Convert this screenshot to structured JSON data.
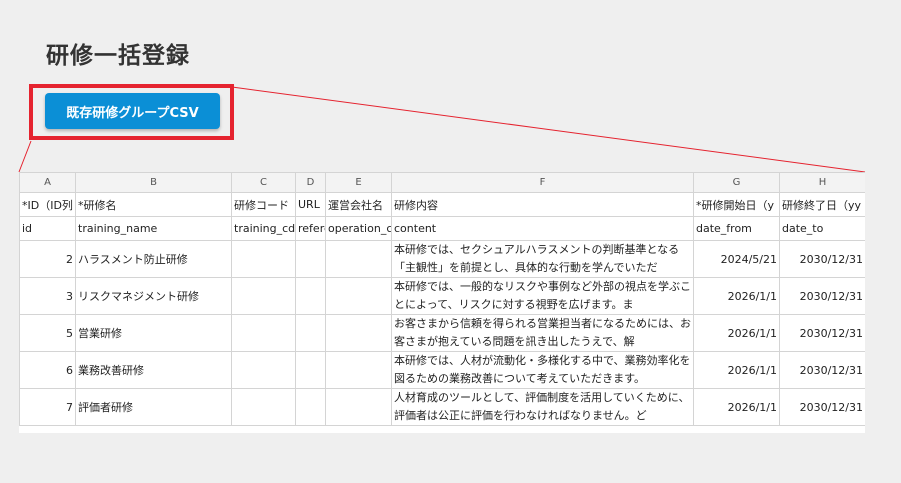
{
  "page": {
    "title": "研修一括登録"
  },
  "toolbar": {
    "csv_button_label": "既存研修グループCSV"
  },
  "colors": {
    "button": "#0b8fd6",
    "highlight": "#e5232f"
  },
  "sheet": {
    "column_letters": [
      "A",
      "B",
      "C",
      "D",
      "E",
      "F",
      "G",
      "H"
    ],
    "header_row": [
      "*ID（ID列",
      "*研修名",
      "研修コード",
      "URL",
      "運営会社名",
      "研修内容",
      "*研修開始日（y",
      "研修終了日（yy"
    ],
    "key_row": [
      "id",
      "training_name",
      "training_cd",
      "refere",
      "operation_c",
      "content",
      "date_from",
      "date_to"
    ],
    "rows": [
      {
        "id": "2",
        "name": "ハラスメント防止研修",
        "code": "",
        "url": "",
        "operator": "",
        "content": "本研修では、セクシュアルハラスメントの判断基準となる「主観性」を前提とし、具体的な行動を学んでいただ",
        "date_from": "2024/5/21",
        "date_to": "2030/12/31"
      },
      {
        "id": "3",
        "name": "リスクマネジメント研修",
        "code": "",
        "url": "",
        "operator": "",
        "content": "本研修では、一般的なリスクや事例など外部の視点を学ぶことによって、リスクに対する視野を広げます。ま",
        "date_from": "2026/1/1",
        "date_to": "2030/12/31"
      },
      {
        "id": "5",
        "name": "営業研修",
        "code": "",
        "url": "",
        "operator": "",
        "content": "お客さまから信頼を得られる営業担当者になるためには、お客さまが抱えている問題を訊き出したうえで、解",
        "date_from": "2026/1/1",
        "date_to": "2030/12/31"
      },
      {
        "id": "6",
        "name": "業務改善研修",
        "code": "",
        "url": "",
        "operator": "",
        "content": "本研修では、人材が流動化・多様化する中で、業務効率化を図るための業務改善について考えていただきます。",
        "date_from": "2026/1/1",
        "date_to": "2030/12/31"
      },
      {
        "id": "7",
        "name": "評価者研修",
        "code": "",
        "url": "",
        "operator": "",
        "content": "人材育成のツールとして、評価制度を活用していくために、評価者は公正に評価を行わなければなりません。ど",
        "date_from": "2026/1/1",
        "date_to": "2030/12/31"
      }
    ]
  }
}
